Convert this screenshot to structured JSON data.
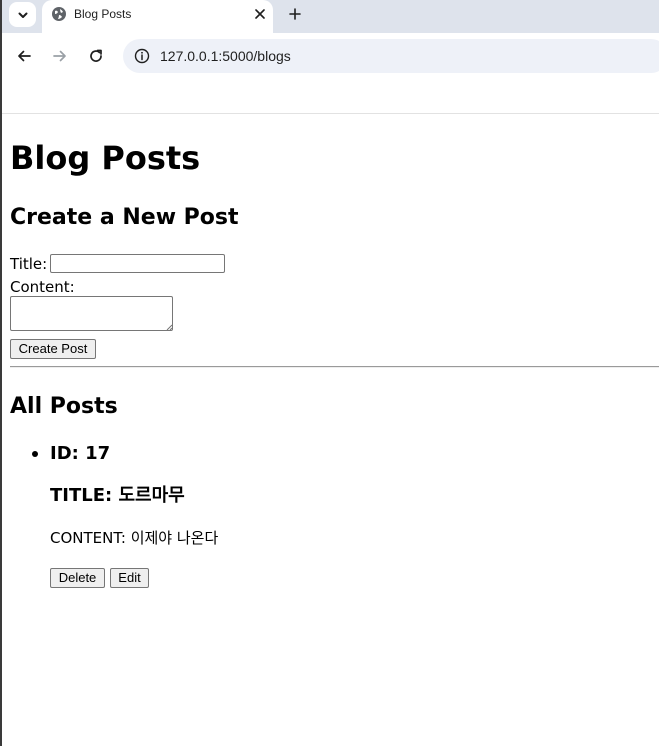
{
  "browser": {
    "tab_title": "Blog Posts",
    "url": "127.0.0.1:5000/blogs",
    "icons": {
      "tab_search": "chevron-down-icon",
      "favicon": "globe-icon",
      "tab_close": "close-icon",
      "new_tab": "plus-icon",
      "back": "arrow-left-icon",
      "forward": "arrow-right-icon",
      "reload": "reload-icon",
      "site_info": "info-icon"
    }
  },
  "page": {
    "heading": "Blog Posts",
    "create_section": {
      "heading": "Create a New Post",
      "title_label": "Title:",
      "title_value": "",
      "content_label": "Content:",
      "content_value": "",
      "submit_label": "Create Post"
    },
    "posts_section": {
      "heading": "All Posts",
      "posts": [
        {
          "id_text": "ID: 17",
          "title_text": "TITLE: 도르마무",
          "content_text": "CONTENT: 이제야 나온다",
          "delete_label": "Delete",
          "edit_label": "Edit"
        }
      ]
    }
  },
  "colors": {
    "tabstrip": "#dee3ec",
    "omnibox": "#eef1f8",
    "button": "#efefef"
  }
}
